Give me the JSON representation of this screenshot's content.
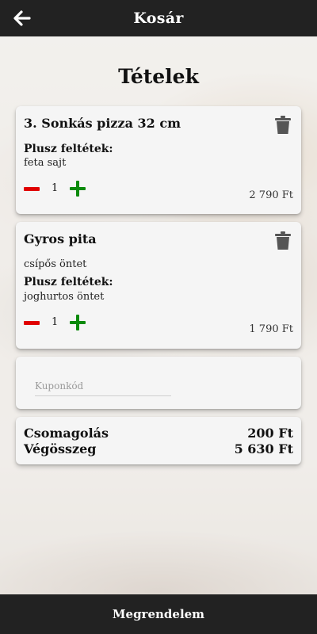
{
  "header": {
    "title": "Kosár",
    "back_icon": "arrow-left-icon"
  },
  "main": {
    "section_title": "Tételek"
  },
  "cart_items": [
    {
      "title": "3. Sonkás pizza 32 cm",
      "note": "",
      "extras_label": "Plusz feltétek:",
      "extras": "feta sajt",
      "quantity": "1",
      "price": "2 790 Ft"
    },
    {
      "title": "Gyros pita",
      "note": "csípős öntet",
      "extras_label": "Plusz feltétek:",
      "extras": "joghurtos öntet",
      "quantity": "1",
      "price": "1 790 Ft"
    }
  ],
  "coupon": {
    "placeholder": "Kuponkód",
    "value": ""
  },
  "summary": {
    "packaging_label": "Csomagolás",
    "packaging_value": "200 Ft",
    "total_label": "Végösszeg",
    "total_value": "5 630 Ft"
  },
  "footer": {
    "order_label": "Megrendelem"
  },
  "colors": {
    "header_bg": "#222222",
    "minus": "#e00000",
    "plus": "#0b8a0b",
    "trash": "#555555"
  }
}
